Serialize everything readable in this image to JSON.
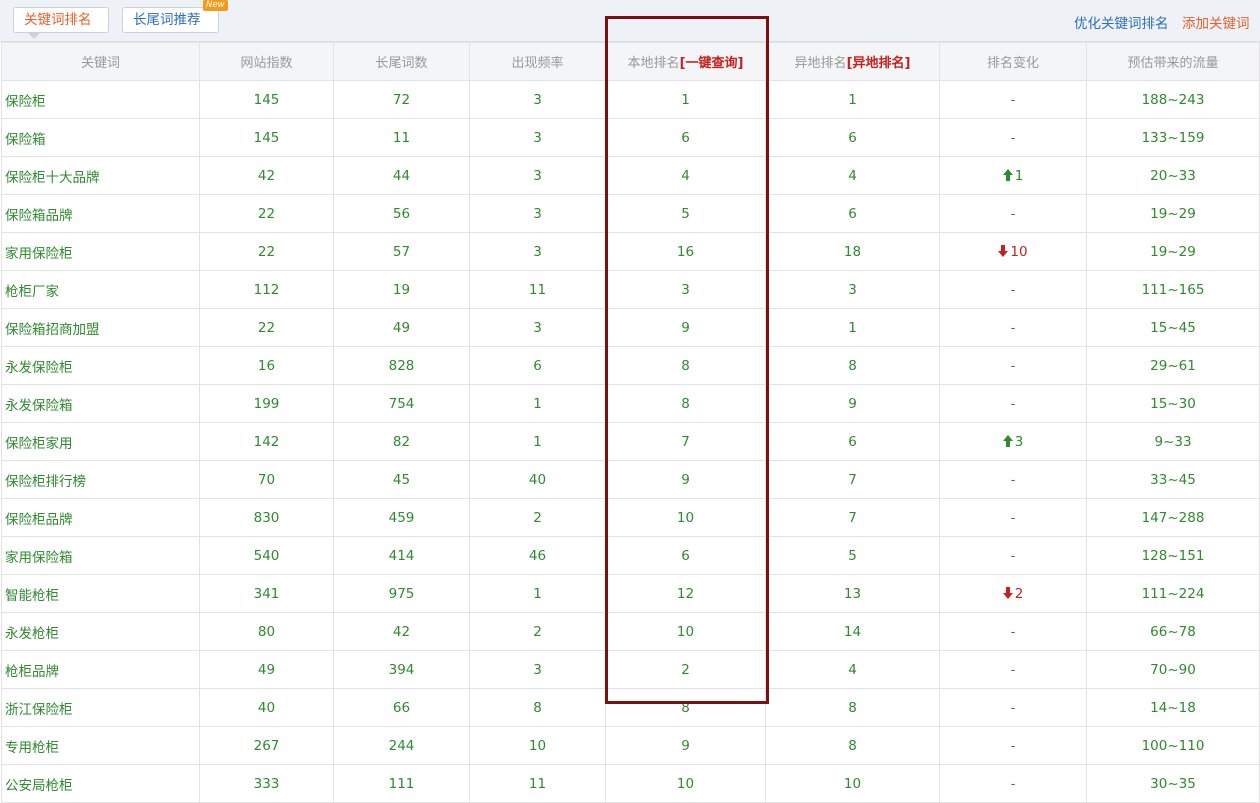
{
  "tabs": {
    "active": "关键词排名",
    "second": "长尾词推荐",
    "new_badge": "New"
  },
  "top_links": {
    "optimize": "优化关键词排名",
    "add": "添加关键词"
  },
  "table": {
    "headers": {
      "keyword": "关键词",
      "index": "网站指数",
      "longtail": "长尾词数",
      "frequency": "出现频率",
      "local_rank": "本地排名",
      "local_rank_link": "[一键查询]",
      "remote_rank": "异地排名",
      "remote_rank_link": "[异地排名]",
      "change": "排名变化",
      "traffic": "预估带来的流量"
    },
    "rows": [
      {
        "keyword": "保险柜",
        "index": "145",
        "longtail": "72",
        "frequency": "3",
        "local": "1",
        "remote": "1",
        "change": "-",
        "dir": "none",
        "traffic": "188~243"
      },
      {
        "keyword": "保险箱",
        "index": "145",
        "longtail": "11",
        "frequency": "3",
        "local": "6",
        "remote": "6",
        "change": "-",
        "dir": "none",
        "traffic": "133~159"
      },
      {
        "keyword": "保险柜十大品牌",
        "index": "42",
        "longtail": "44",
        "frequency": "3",
        "local": "4",
        "remote": "4",
        "change": "1",
        "dir": "up",
        "traffic": "20~33"
      },
      {
        "keyword": "保险箱品牌",
        "index": "22",
        "longtail": "56",
        "frequency": "3",
        "local": "5",
        "remote": "6",
        "change": "-",
        "dir": "none",
        "traffic": "19~29"
      },
      {
        "keyword": "家用保险柜",
        "index": "22",
        "longtail": "57",
        "frequency": "3",
        "local": "16",
        "remote": "18",
        "change": "10",
        "dir": "down",
        "traffic": "19~29"
      },
      {
        "keyword": "枪柜厂家",
        "index": "112",
        "longtail": "19",
        "frequency": "11",
        "local": "3",
        "remote": "3",
        "change": "-",
        "dir": "none",
        "traffic": "111~165"
      },
      {
        "keyword": "保险箱招商加盟",
        "index": "22",
        "longtail": "49",
        "frequency": "3",
        "local": "9",
        "remote": "1",
        "change": "-",
        "dir": "none",
        "traffic": "15~45"
      },
      {
        "keyword": "永发保险柜",
        "index": "16",
        "longtail": "828",
        "frequency": "6",
        "local": "8",
        "remote": "8",
        "change": "-",
        "dir": "none",
        "traffic": "29~61"
      },
      {
        "keyword": "永发保险箱",
        "index": "199",
        "longtail": "754",
        "frequency": "1",
        "local": "8",
        "remote": "9",
        "change": "-",
        "dir": "none",
        "traffic": "15~30"
      },
      {
        "keyword": "保险柜家用",
        "index": "142",
        "longtail": "82",
        "frequency": "1",
        "local": "7",
        "remote": "6",
        "change": "3",
        "dir": "up",
        "traffic": "9~33"
      },
      {
        "keyword": "保险柜排行榜",
        "index": "70",
        "longtail": "45",
        "frequency": "40",
        "local": "9",
        "remote": "7",
        "change": "-",
        "dir": "none",
        "traffic": "33~45"
      },
      {
        "keyword": "保险柜品牌",
        "index": "830",
        "longtail": "459",
        "frequency": "2",
        "local": "10",
        "remote": "7",
        "change": "-",
        "dir": "none",
        "traffic": "147~288"
      },
      {
        "keyword": "家用保险箱",
        "index": "540",
        "longtail": "414",
        "frequency": "46",
        "local": "6",
        "remote": "5",
        "change": "-",
        "dir": "none",
        "traffic": "128~151"
      },
      {
        "keyword": "智能枪柜",
        "index": "341",
        "longtail": "975",
        "frequency": "1",
        "local": "12",
        "remote": "13",
        "change": "2",
        "dir": "down",
        "traffic": "111~224"
      },
      {
        "keyword": "永发枪柜",
        "index": "80",
        "longtail": "42",
        "frequency": "2",
        "local": "10",
        "remote": "14",
        "change": "-",
        "dir": "none",
        "traffic": "66~78"
      },
      {
        "keyword": "枪柜品牌",
        "index": "49",
        "longtail": "394",
        "frequency": "3",
        "local": "2",
        "remote": "4",
        "change": "-",
        "dir": "none",
        "traffic": "70~90"
      },
      {
        "keyword": "浙江保险柜",
        "index": "40",
        "longtail": "66",
        "frequency": "8",
        "local": "8",
        "remote": "8",
        "change": "-",
        "dir": "none",
        "traffic": "14~18"
      },
      {
        "keyword": "专用枪柜",
        "index": "267",
        "longtail": "244",
        "frequency": "10",
        "local": "9",
        "remote": "8",
        "change": "-",
        "dir": "none",
        "traffic": "100~110"
      },
      {
        "keyword": "公安局枪柜",
        "index": "333",
        "longtail": "111",
        "frequency": "11",
        "local": "10",
        "remote": "10",
        "change": "-",
        "dir": "none",
        "traffic": "30~35"
      }
    ]
  },
  "colors": {
    "accent_orange": "#e8612c",
    "link_blue": "#2a6fc2",
    "value_green": "#2e8b2e",
    "down_red": "#c5221f",
    "highlight_box": "#7e0f0f"
  }
}
